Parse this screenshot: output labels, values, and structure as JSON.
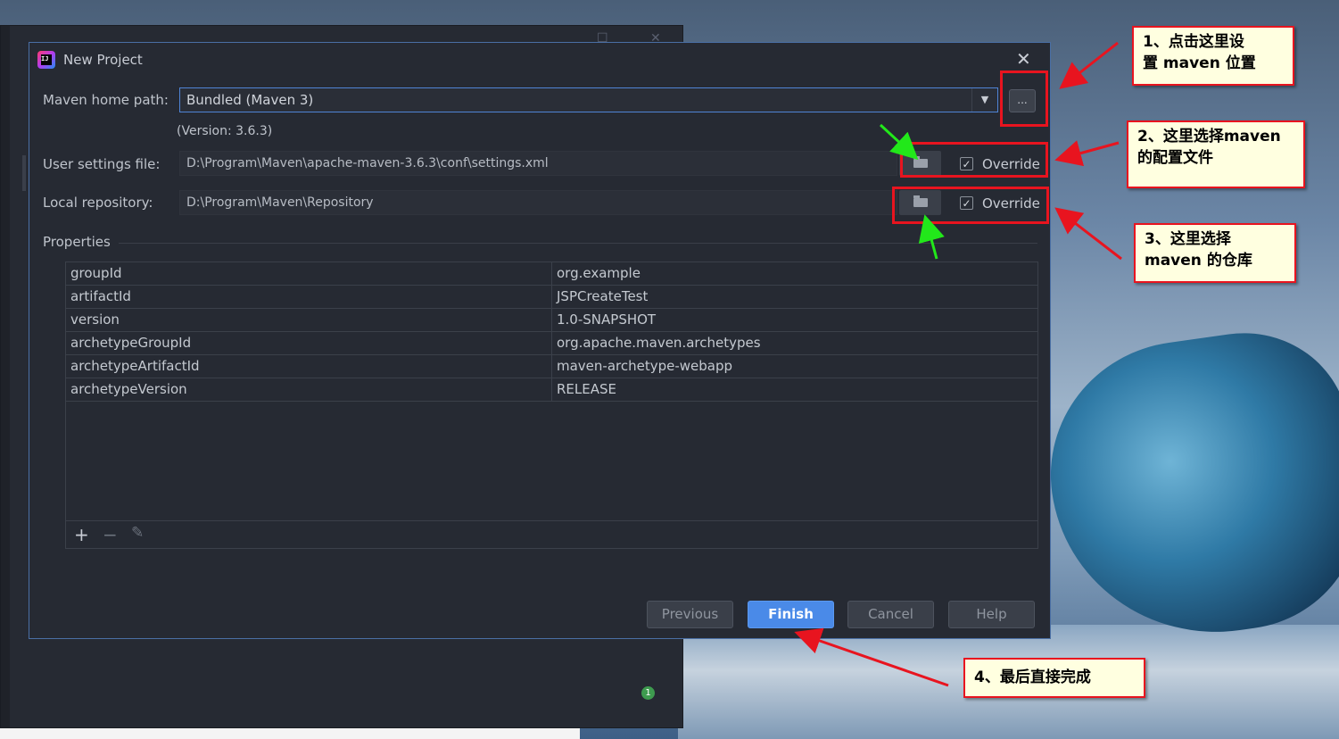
{
  "dialog": {
    "title": "New Project",
    "logo_text": "IJ",
    "close_icon": "close-icon",
    "maven_home_label": "Maven home path:",
    "maven_home_value": "Bundled (Maven 3)",
    "browse_label": "...",
    "version_text": "(Version: 3.6.3)",
    "user_settings_label": "User settings file:",
    "user_settings_value": "D:\\Program\\Maven\\apache-maven-3.6.3\\conf\\settings.xml",
    "local_repo_label": "Local repository:",
    "local_repo_value": "D:\\Program\\Maven\\Repository",
    "override_label": "Override",
    "properties_label": "Properties",
    "properties": [
      {
        "key": "groupId",
        "value": "org.example"
      },
      {
        "key": "artifactId",
        "value": "JSPCreateTest"
      },
      {
        "key": "version",
        "value": "1.0-SNAPSHOT"
      },
      {
        "key": "archetypeGroupId",
        "value": "org.apache.maven.archetypes"
      },
      {
        "key": "archetypeArtifactId",
        "value": "maven-archetype-webapp"
      },
      {
        "key": "archetypeVersion",
        "value": "RELEASE"
      }
    ],
    "toolbar": {
      "add": "+",
      "remove": "−",
      "edit": "✎"
    },
    "buttons": {
      "previous": "Previous",
      "finish": "Finish",
      "cancel": "Cancel",
      "help": "Help"
    }
  },
  "ide": {
    "notification_count": "1"
  },
  "annotations": {
    "note1_line1": "1、点击这里设",
    "note1_line2": "置 maven 位置",
    "note2_line1": "2、这里选择maven",
    "note2_line2": "的配置文件",
    "note3_line1": "3、这里选择",
    "note3_line2": "maven 的仓库",
    "note4": "4、最后直接完成"
  },
  "colors": {
    "accent": "#4a8ae8",
    "annotation_red": "#e8141f",
    "annotation_green": "#22e81a",
    "note_bg": "#ffffe0"
  }
}
